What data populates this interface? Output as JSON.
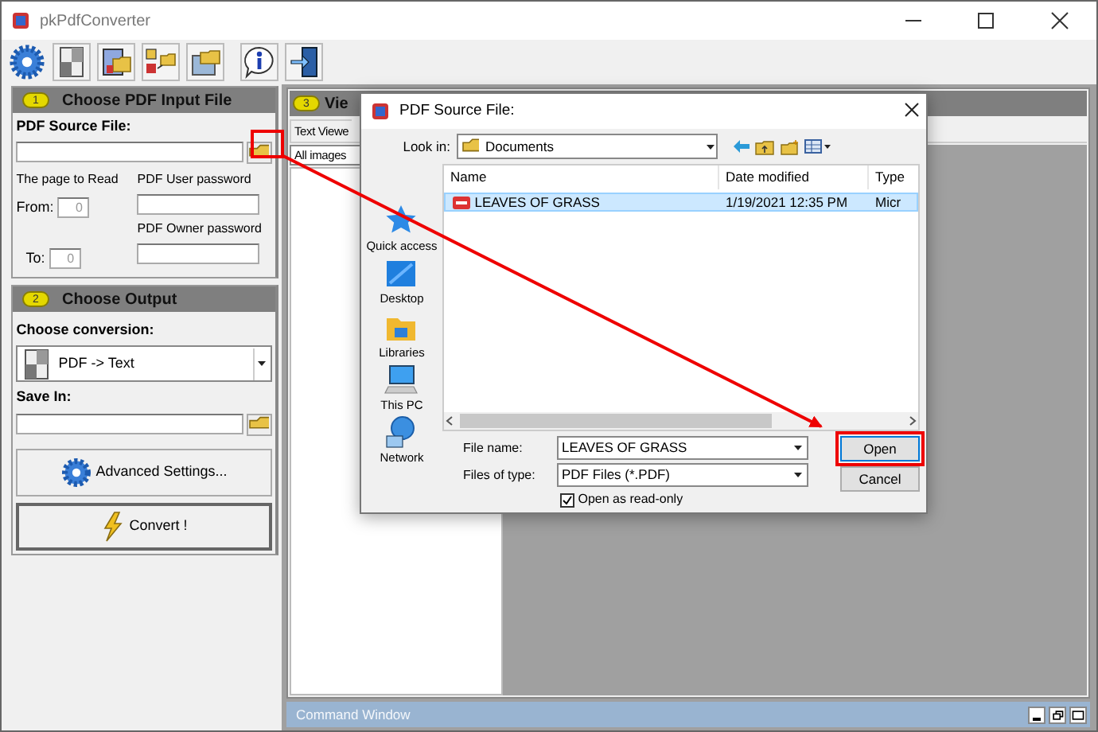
{
  "window": {
    "title": "pkPdfConverter"
  },
  "input_panel": {
    "number": "1",
    "title": "Choose PDF Input File",
    "source_label": "PDF Source File:",
    "page_label": "The page to Read",
    "from_label": "From:",
    "from_value": "0",
    "to_label": "To:",
    "to_value": "0",
    "user_password_label": "PDF User password",
    "owner_password_label": "PDF Owner  password"
  },
  "output_panel": {
    "number": "2",
    "title": "Choose Output",
    "conversion_label": "Choose conversion:",
    "conversion": "PDF -> Text",
    "save_label": "Save In:",
    "buttons": [
      {
        "label": "Advanced Settings...",
        "kind": "settings"
      },
      {
        "label": "Convert !",
        "kind": "convert"
      }
    ]
  },
  "view_panel": {
    "number": "3",
    "title": "Vie",
    "tab": "Text Viewe",
    "filter": "All images"
  },
  "command_window": {
    "title": "Command Window"
  },
  "dialog": {
    "title": "PDF Source File:",
    "look_in_label": "Look in:",
    "look_in": "Documents",
    "places": [
      {
        "label": "Quick access",
        "kind": "star"
      },
      {
        "label": "Desktop",
        "kind": "desktop"
      },
      {
        "label": "Libraries",
        "kind": "library"
      },
      {
        "label": "This PC",
        "kind": "pc"
      },
      {
        "label": "Network",
        "kind": "network"
      }
    ],
    "columns": [
      "Name",
      "Date modified",
      "Type"
    ],
    "files": [
      {
        "name": "LEAVES OF GRASS",
        "date": "1/19/2021 12:35 PM",
        "type": "Micr",
        "selected": true
      }
    ],
    "file_name_label": "File name:",
    "file_name": "LEAVES OF GRASS",
    "file_type_label": "Files of type:",
    "file_type": "PDF Files (*.PDF)",
    "read_only": {
      "label": "Open as read-only",
      "checked": true
    },
    "buttons": [
      "Open",
      "Cancel"
    ]
  }
}
